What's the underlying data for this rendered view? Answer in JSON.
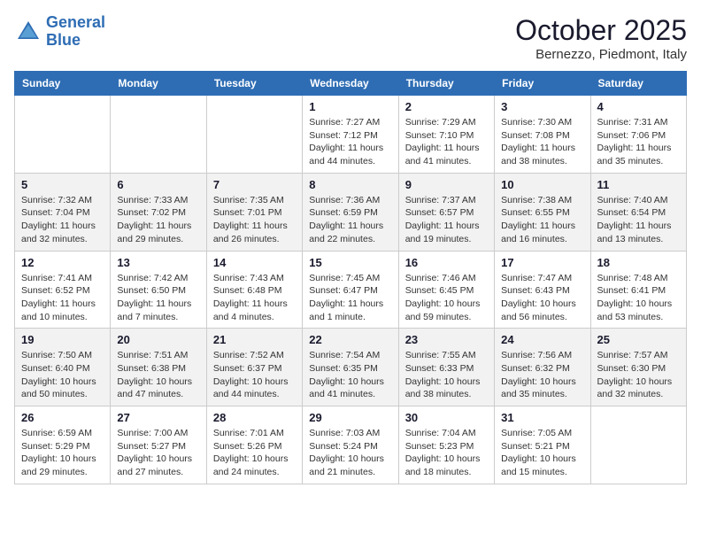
{
  "header": {
    "logo_line1": "General",
    "logo_line2": "Blue",
    "month_title": "October 2025",
    "location": "Bernezzo, Piedmont, Italy"
  },
  "weekdays": [
    "Sunday",
    "Monday",
    "Tuesday",
    "Wednesday",
    "Thursday",
    "Friday",
    "Saturday"
  ],
  "weeks": [
    [
      {
        "day": "",
        "info": ""
      },
      {
        "day": "",
        "info": ""
      },
      {
        "day": "",
        "info": ""
      },
      {
        "day": "1",
        "info": "Sunrise: 7:27 AM\nSunset: 7:12 PM\nDaylight: 11 hours\nand 44 minutes."
      },
      {
        "day": "2",
        "info": "Sunrise: 7:29 AM\nSunset: 7:10 PM\nDaylight: 11 hours\nand 41 minutes."
      },
      {
        "day": "3",
        "info": "Sunrise: 7:30 AM\nSunset: 7:08 PM\nDaylight: 11 hours\nand 38 minutes."
      },
      {
        "day": "4",
        "info": "Sunrise: 7:31 AM\nSunset: 7:06 PM\nDaylight: 11 hours\nand 35 minutes."
      }
    ],
    [
      {
        "day": "5",
        "info": "Sunrise: 7:32 AM\nSunset: 7:04 PM\nDaylight: 11 hours\nand 32 minutes."
      },
      {
        "day": "6",
        "info": "Sunrise: 7:33 AM\nSunset: 7:02 PM\nDaylight: 11 hours\nand 29 minutes."
      },
      {
        "day": "7",
        "info": "Sunrise: 7:35 AM\nSunset: 7:01 PM\nDaylight: 11 hours\nand 26 minutes."
      },
      {
        "day": "8",
        "info": "Sunrise: 7:36 AM\nSunset: 6:59 PM\nDaylight: 11 hours\nand 22 minutes."
      },
      {
        "day": "9",
        "info": "Sunrise: 7:37 AM\nSunset: 6:57 PM\nDaylight: 11 hours\nand 19 minutes."
      },
      {
        "day": "10",
        "info": "Sunrise: 7:38 AM\nSunset: 6:55 PM\nDaylight: 11 hours\nand 16 minutes."
      },
      {
        "day": "11",
        "info": "Sunrise: 7:40 AM\nSunset: 6:54 PM\nDaylight: 11 hours\nand 13 minutes."
      }
    ],
    [
      {
        "day": "12",
        "info": "Sunrise: 7:41 AM\nSunset: 6:52 PM\nDaylight: 11 hours\nand 10 minutes."
      },
      {
        "day": "13",
        "info": "Sunrise: 7:42 AM\nSunset: 6:50 PM\nDaylight: 11 hours\nand 7 minutes."
      },
      {
        "day": "14",
        "info": "Sunrise: 7:43 AM\nSunset: 6:48 PM\nDaylight: 11 hours\nand 4 minutes."
      },
      {
        "day": "15",
        "info": "Sunrise: 7:45 AM\nSunset: 6:47 PM\nDaylight: 11 hours\nand 1 minute."
      },
      {
        "day": "16",
        "info": "Sunrise: 7:46 AM\nSunset: 6:45 PM\nDaylight: 10 hours\nand 59 minutes."
      },
      {
        "day": "17",
        "info": "Sunrise: 7:47 AM\nSunset: 6:43 PM\nDaylight: 10 hours\nand 56 minutes."
      },
      {
        "day": "18",
        "info": "Sunrise: 7:48 AM\nSunset: 6:41 PM\nDaylight: 10 hours\nand 53 minutes."
      }
    ],
    [
      {
        "day": "19",
        "info": "Sunrise: 7:50 AM\nSunset: 6:40 PM\nDaylight: 10 hours\nand 50 minutes."
      },
      {
        "day": "20",
        "info": "Sunrise: 7:51 AM\nSunset: 6:38 PM\nDaylight: 10 hours\nand 47 minutes."
      },
      {
        "day": "21",
        "info": "Sunrise: 7:52 AM\nSunset: 6:37 PM\nDaylight: 10 hours\nand 44 minutes."
      },
      {
        "day": "22",
        "info": "Sunrise: 7:54 AM\nSunset: 6:35 PM\nDaylight: 10 hours\nand 41 minutes."
      },
      {
        "day": "23",
        "info": "Sunrise: 7:55 AM\nSunset: 6:33 PM\nDaylight: 10 hours\nand 38 minutes."
      },
      {
        "day": "24",
        "info": "Sunrise: 7:56 AM\nSunset: 6:32 PM\nDaylight: 10 hours\nand 35 minutes."
      },
      {
        "day": "25",
        "info": "Sunrise: 7:57 AM\nSunset: 6:30 PM\nDaylight: 10 hours\nand 32 minutes."
      }
    ],
    [
      {
        "day": "26",
        "info": "Sunrise: 6:59 AM\nSunset: 5:29 PM\nDaylight: 10 hours\nand 29 minutes."
      },
      {
        "day": "27",
        "info": "Sunrise: 7:00 AM\nSunset: 5:27 PM\nDaylight: 10 hours\nand 27 minutes."
      },
      {
        "day": "28",
        "info": "Sunrise: 7:01 AM\nSunset: 5:26 PM\nDaylight: 10 hours\nand 24 minutes."
      },
      {
        "day": "29",
        "info": "Sunrise: 7:03 AM\nSunset: 5:24 PM\nDaylight: 10 hours\nand 21 minutes."
      },
      {
        "day": "30",
        "info": "Sunrise: 7:04 AM\nSunset: 5:23 PM\nDaylight: 10 hours\nand 18 minutes."
      },
      {
        "day": "31",
        "info": "Sunrise: 7:05 AM\nSunset: 5:21 PM\nDaylight: 10 hours\nand 15 minutes."
      },
      {
        "day": "",
        "info": ""
      }
    ]
  ]
}
